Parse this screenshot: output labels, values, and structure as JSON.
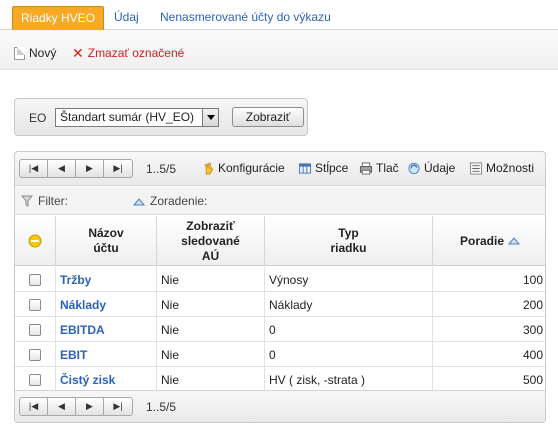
{
  "tabs": [
    {
      "label": "Riadky HVEO",
      "active": true
    },
    {
      "label": "Údaj",
      "active": false
    },
    {
      "label": "Nenasmerované účty do výkazu",
      "active": false
    }
  ],
  "toolbar": {
    "new_label": "Nový",
    "delete_label": "Zmazať označené"
  },
  "eo_filter": {
    "label": "EO",
    "selected": "Štandart sumár (HV_EO)",
    "show_button": "Zobraziť"
  },
  "grid": {
    "pager_info": "1..5/5",
    "tools": {
      "config": "Konfigurácie",
      "columns": "Stĺpce",
      "print": "Tlač",
      "data": "Údaje",
      "options": "Možnosti"
    },
    "filter_label": "Filter:",
    "sort_label": "Zoradenie:",
    "headers": {
      "name": [
        "Názov",
        "účtu"
      ],
      "tracked": [
        "Zobraziť",
        "sledované",
        "AÚ"
      ],
      "type": [
        "Typ",
        "riadku"
      ],
      "order": "Poradie"
    },
    "rows": [
      {
        "name": "Tržby",
        "tracked": "Nie",
        "type": "Výnosy",
        "order": "100"
      },
      {
        "name": "Náklady",
        "tracked": "Nie",
        "type": "Náklady",
        "order": "200"
      },
      {
        "name": "EBITDA",
        "tracked": "Nie",
        "type": "0",
        "order": "300"
      },
      {
        "name": "EBIT",
        "tracked": "Nie",
        "type": "0",
        "order": "400"
      },
      {
        "name": "Čistý zisk",
        "tracked": "Nie",
        "type": "HV ( zisk, -strata )",
        "order": "500"
      }
    ]
  },
  "colors": {
    "active_tab": "#f7a824",
    "link": "#2b63b8",
    "danger": "#cc2020"
  }
}
